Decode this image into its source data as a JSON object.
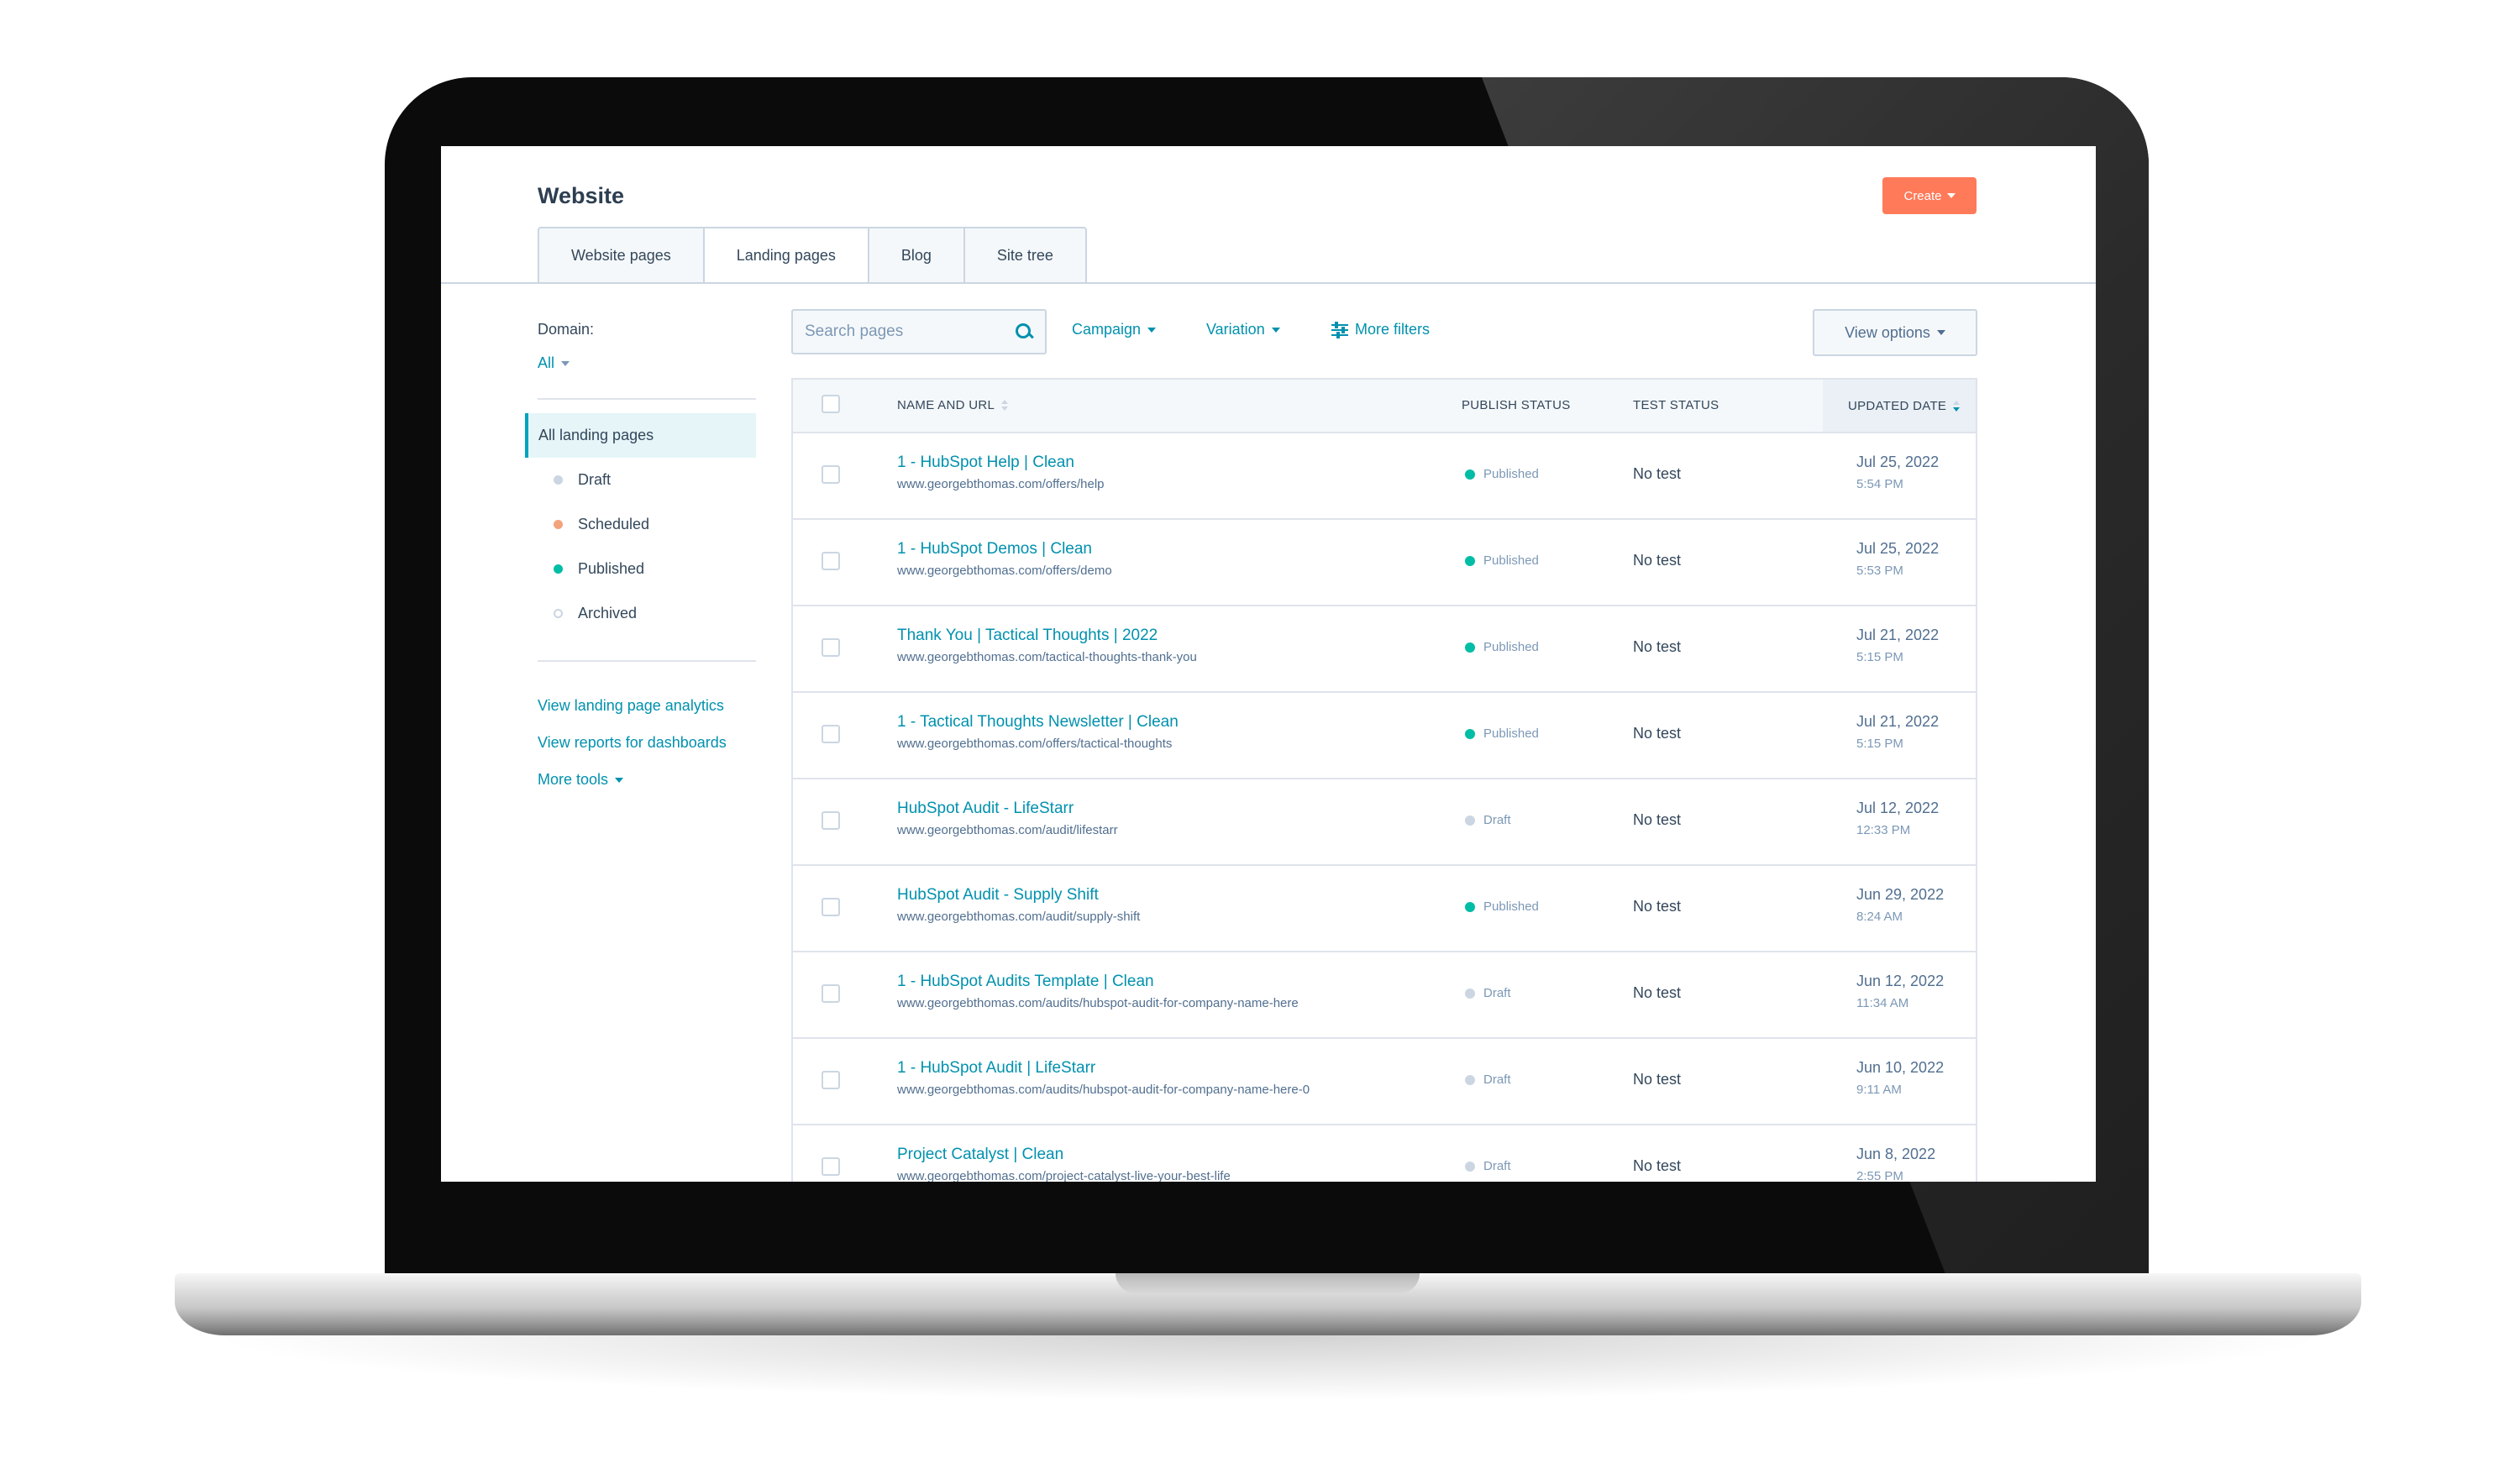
{
  "page": {
    "title": "Website",
    "create_label": "Create"
  },
  "tabs": [
    {
      "label": "Website pages"
    },
    {
      "label": "Landing pages"
    },
    {
      "label": "Blog"
    },
    {
      "label": "Site tree"
    }
  ],
  "sidebar": {
    "domain_label": "Domain:",
    "domain_value": "All",
    "items": [
      {
        "label": "All landing pages",
        "dot_color": ""
      },
      {
        "label": "Draft",
        "dot_color": "#cbd6e2"
      },
      {
        "label": "Scheduled",
        "dot_color": "#f2a37b"
      },
      {
        "label": "Published",
        "dot_color": "#00bda5"
      },
      {
        "label": "Archived",
        "dot_color": "outline"
      }
    ],
    "links": [
      {
        "label": "View landing page analytics"
      },
      {
        "label": "View reports for dashboards"
      },
      {
        "label": "More tools"
      }
    ]
  },
  "filters": {
    "search_placeholder": "Search pages",
    "campaign": "Campaign",
    "variation": "Variation",
    "more_filters": "More filters",
    "view_options": "View options"
  },
  "table": {
    "columns": {
      "name": "NAME AND URL",
      "publish": "PUBLISH STATUS",
      "test": "TEST STATUS",
      "updated": "UPDATED DATE"
    },
    "rows": [
      {
        "name": "1 - HubSpot Help | Clean",
        "url": "www.georgebthomas.com/offers/help",
        "status": "Published",
        "test": "No test",
        "date": "Jul 25, 2022",
        "time": "5:54 PM"
      },
      {
        "name": "1 - HubSpot Demos | Clean",
        "url": "www.georgebthomas.com/offers/demo",
        "status": "Published",
        "test": "No test",
        "date": "Jul 25, 2022",
        "time": "5:53 PM"
      },
      {
        "name": "Thank You | Tactical Thoughts | 2022",
        "url": "www.georgebthomas.com/tactical-thoughts-thank-you",
        "status": "Published",
        "test": "No test",
        "date": "Jul 21, 2022",
        "time": "5:15 PM"
      },
      {
        "name": "1 - Tactical Thoughts Newsletter | Clean",
        "url": "www.georgebthomas.com/offers/tactical-thoughts",
        "status": "Published",
        "test": "No test",
        "date": "Jul 21, 2022",
        "time": "5:15 PM"
      },
      {
        "name": "HubSpot Audit - LifeStarr",
        "url": "www.georgebthomas.com/audit/lifestarr",
        "status": "Draft",
        "test": "No test",
        "date": "Jul 12, 2022",
        "time": "12:33 PM"
      },
      {
        "name": "HubSpot Audit - Supply Shift",
        "url": "www.georgebthomas.com/audit/supply-shift",
        "status": "Published",
        "test": "No test",
        "date": "Jun 29, 2022",
        "time": "8:24 AM"
      },
      {
        "name": "1 - HubSpot Audits Template | Clean",
        "url": "www.georgebthomas.com/audits/hubspot-audit-for-company-name-here",
        "status": "Draft",
        "test": "No test",
        "date": "Jun 12, 2022",
        "time": "11:34 AM"
      },
      {
        "name": "1 - HubSpot Audit | LifeStarr",
        "url": "www.georgebthomas.com/audits/hubspot-audit-for-company-name-here-0",
        "status": "Draft",
        "test": "No test",
        "date": "Jun 10, 2022",
        "time": "9:11 AM"
      },
      {
        "name": "Project Catalyst | Clean",
        "url": "www.georgebthomas.com/project-catalyst-live-your-best-life",
        "status": "Draft",
        "test": "No test",
        "date": "Jun 8, 2022",
        "time": "2:55 PM"
      }
    ]
  },
  "colors": {
    "accent": "#0091ae",
    "create": "#ff7a59",
    "published": "#00bda5",
    "draft": "#cbd6e2"
  }
}
